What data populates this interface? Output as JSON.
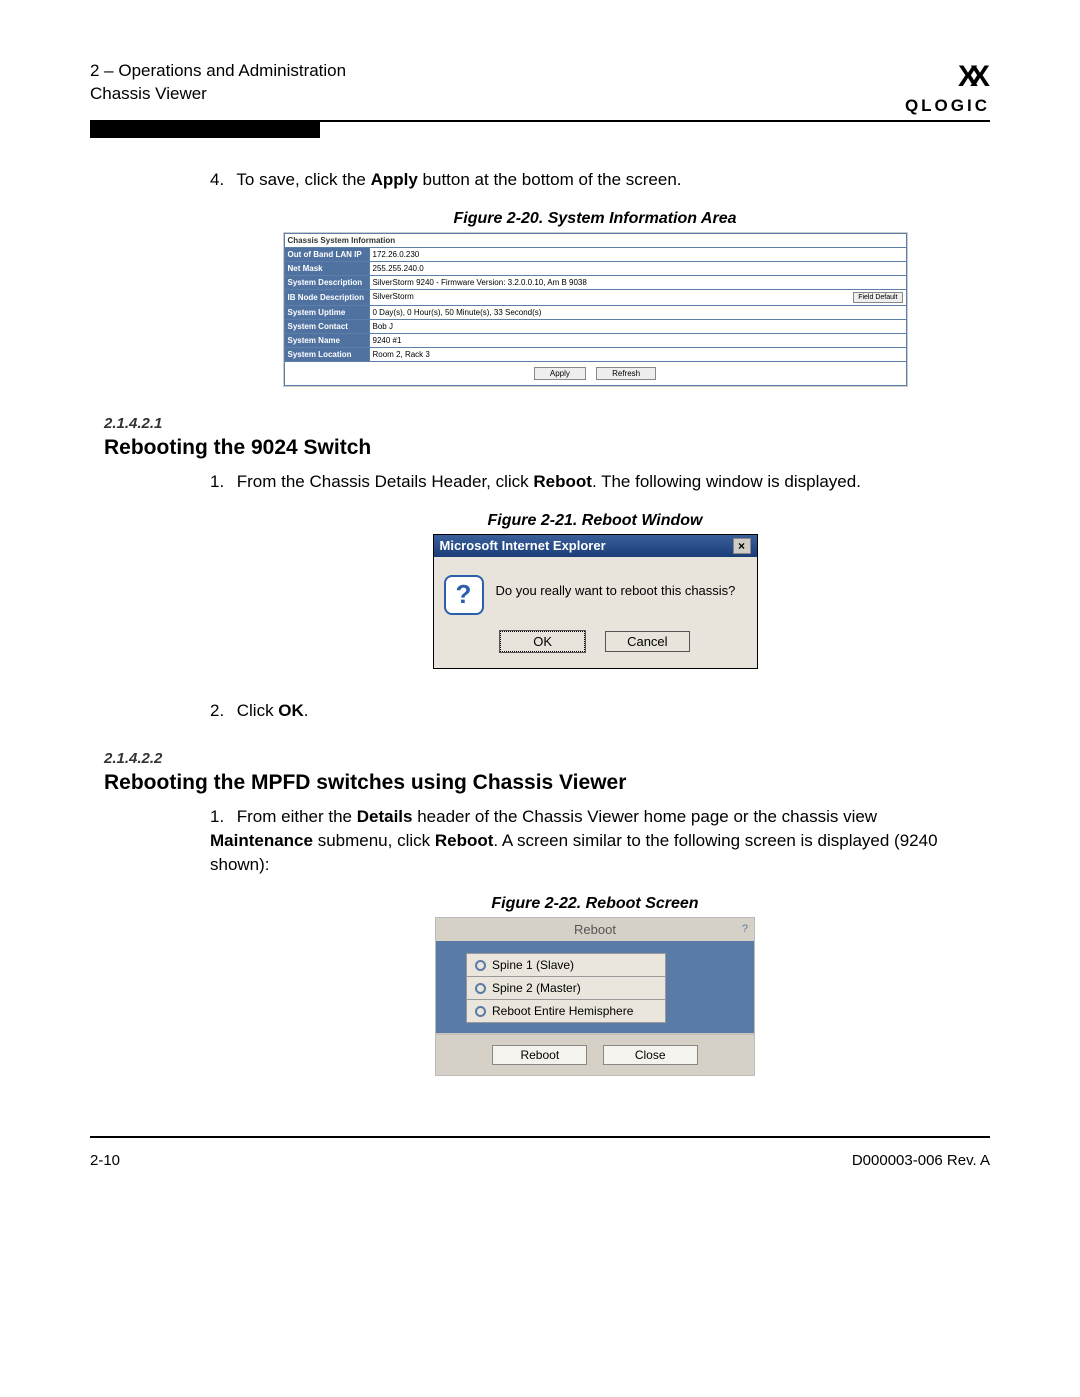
{
  "header": {
    "line1": "2 – Operations and Administration",
    "line2": "Chassis Viewer",
    "logo_text": "QLOGIC"
  },
  "step4": {
    "num": "4.",
    "pre": "To save, click the ",
    "bold": "Apply",
    "post": " button at the bottom of the screen."
  },
  "fig20": {
    "caption": "Figure 2-20. System Information Area",
    "title": "Chassis System Information",
    "rows": [
      {
        "label": "Out of Band LAN IP",
        "value": "172.26.0.230"
      },
      {
        "label": "Net Mask",
        "value": "255.255.240.0"
      },
      {
        "label": "System Description",
        "value": "SilverStorm 9240 - Firmware Version: 3.2.0.0.10, Am B 9038"
      },
      {
        "label": "IB Node Description",
        "value": "SilverStorm"
      },
      {
        "label": "System Uptime",
        "value": "0 Day(s), 0 Hour(s), 50 Minute(s), 33 Second(s)"
      },
      {
        "label": "System Contact",
        "value": "Bob J"
      },
      {
        "label": "System Name",
        "value": "9240 #1"
      },
      {
        "label": "System Location",
        "value": "Room 2, Rack 3"
      }
    ],
    "field_default": "Field Default",
    "apply": "Apply",
    "refresh": "Refresh"
  },
  "sec1": {
    "num": "2.1.4.2.1",
    "title": "Rebooting the 9024 Switch",
    "step1": {
      "num": "1.",
      "pre": "From the Chassis Details Header, click ",
      "bold": "Reboot",
      "post": ". The following window is displayed."
    },
    "step2": {
      "num": "2.",
      "pre": "Click ",
      "bold": "OK",
      "post": "."
    }
  },
  "fig21": {
    "caption": "Figure 2-21. Reboot Window",
    "title": "Microsoft Internet Explorer",
    "msg": "Do you really want to reboot this chassis?",
    "ok": "OK",
    "cancel": "Cancel"
  },
  "sec2": {
    "num": "2.1.4.2.2",
    "title": "Rebooting the MPFD switches using Chassis Viewer",
    "step1": {
      "num": "1.",
      "t1": "From either the ",
      "b1": "Details",
      "t2": " header of the Chassis Viewer home page or the chassis view ",
      "b2": "Maintenance",
      "t3": " submenu, click ",
      "b3": "Reboot",
      "t4": ". A screen similar to the following screen is displayed (9240 shown):"
    }
  },
  "fig22": {
    "caption": "Figure 2-22. Reboot Screen",
    "title": "Reboot",
    "help": "?",
    "items": [
      "Spine 1 (Slave)",
      "Spine 2 (Master)",
      "Reboot Entire Hemisphere"
    ],
    "reboot": "Reboot",
    "close": "Close"
  },
  "footer": {
    "left": "2-10",
    "right": "D000003-006 Rev. A"
  }
}
